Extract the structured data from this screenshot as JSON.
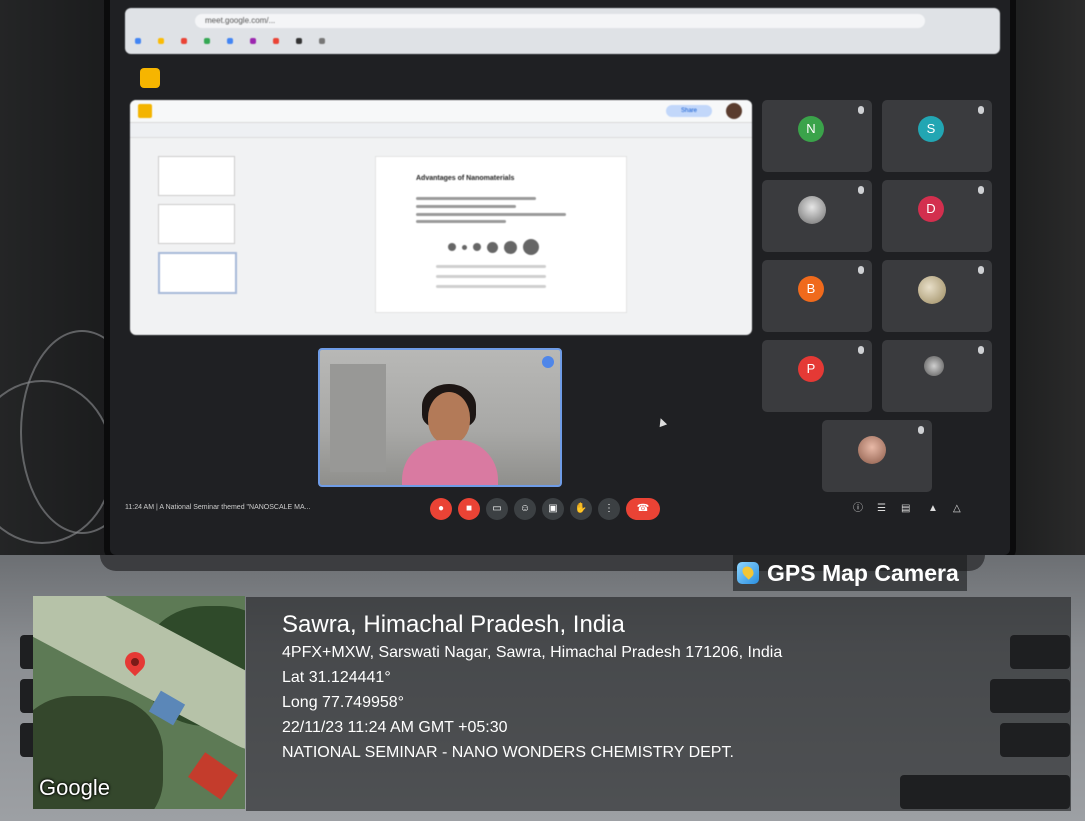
{
  "browser": {
    "url": "meet.google.com/...",
    "bookmarks": [
      "",
      "",
      "",
      "",
      "",
      "",
      "",
      "",
      ""
    ]
  },
  "slides": {
    "share_label": "Share",
    "slide_heading": "Advantages of Nanomaterials"
  },
  "participants": [
    {
      "initial": "N",
      "name": "",
      "color": "#3aa34a"
    },
    {
      "initial": "S",
      "name": "",
      "color": "#22a6b3"
    },
    {
      "initial": "",
      "name": "",
      "color": "#555"
    },
    {
      "initial": "D",
      "name": "",
      "color": "#d32f4e"
    },
    {
      "initial": "B",
      "name": "",
      "color": "#f06a1c"
    },
    {
      "initial": "",
      "name": "",
      "color": "#b09056"
    },
    {
      "initial": "P",
      "name": "",
      "color": "#e53935"
    },
    {
      "initial": "",
      "name": "",
      "color": "#555"
    },
    {
      "initial": "",
      "name": "",
      "color": "#8a5a48"
    }
  ],
  "meeting": {
    "info": "11:24 AM | A National Seminar themed \"NANOSCALE MA..."
  },
  "gps": {
    "app_title": "GPS Map Camera",
    "map_watermark": "Google",
    "location_title": "Sawra, Himachal Pradesh, India",
    "address": "4PFX+MXW, Sarswati Nagar, Sawra, Himachal Pradesh 171206, India",
    "lat": "Lat 31.124441°",
    "long": "Long 77.749958°",
    "datetime": "22/11/23 11:24 AM GMT +05:30",
    "note": "NATIONAL SEMINAR - NANO WONDERS CHEMISTRY DEPT."
  },
  "colors": {
    "accent_blue": "#4f86e9",
    "hangup_red": "#ea4335",
    "overlay_text": "#ffffff"
  }
}
